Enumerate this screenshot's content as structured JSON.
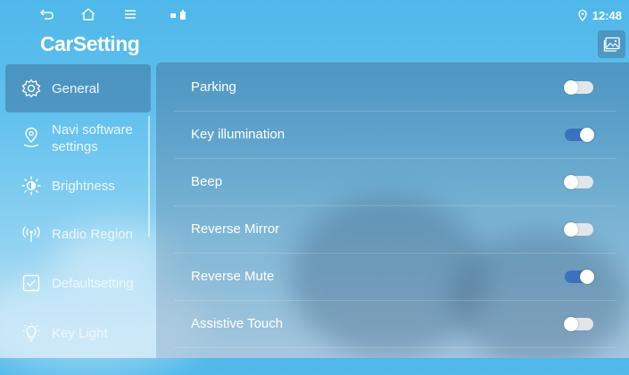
{
  "status_bar": {
    "time": "12:48"
  },
  "app": {
    "title": "CarSetting"
  },
  "sidebar": {
    "items": [
      {
        "label": "General",
        "icon": "gear-icon",
        "active": true
      },
      {
        "label": "Navi software settings",
        "icon": "map-pin-icon",
        "active": false
      },
      {
        "label": "Brightness",
        "icon": "sun-icon",
        "active": false
      },
      {
        "label": "Radio Region",
        "icon": "radio-antenna-icon",
        "active": false
      },
      {
        "label": "Defaultsetting",
        "icon": "checkbox-icon",
        "active": false
      },
      {
        "label": "Key Light",
        "icon": "lightbulb-icon",
        "active": false
      }
    ]
  },
  "settings": {
    "rows": [
      {
        "label": "Parking",
        "on": false
      },
      {
        "label": "Key illumination",
        "on": true
      },
      {
        "label": "Beep",
        "on": false
      },
      {
        "label": "Reverse Mirror",
        "on": false
      },
      {
        "label": "Reverse Mute",
        "on": true
      },
      {
        "label": "Assistive Touch",
        "on": false
      }
    ]
  },
  "colors": {
    "toggle_on": "#3a72c0",
    "toggle_off": "#e3e6e9",
    "sky": "#4fb8ea"
  }
}
